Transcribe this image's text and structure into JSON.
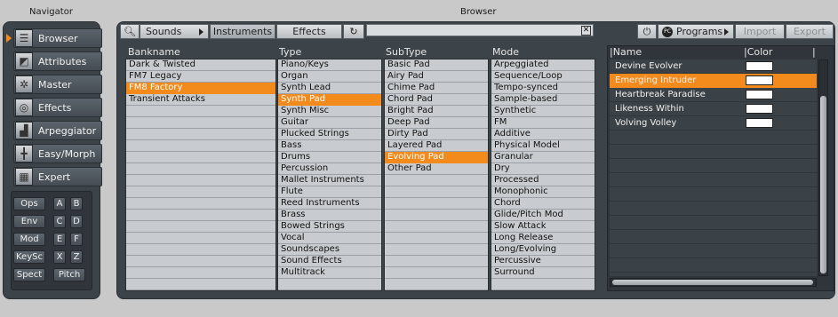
{
  "navigator": {
    "title": "Navigator",
    "items": [
      {
        "label": "Browser",
        "icon": "list-icon"
      },
      {
        "label": "Attributes",
        "icon": "slider-icon"
      },
      {
        "label": "Master",
        "icon": "gear-icon"
      },
      {
        "label": "Effects",
        "icon": "target-icon"
      },
      {
        "label": "Arpeggiator",
        "icon": "bars-icon"
      },
      {
        "label": "Easy/Morph",
        "icon": "grid-icon"
      },
      {
        "label": "Expert",
        "icon": "expert-icon"
      }
    ],
    "ops": {
      "ops": "Ops",
      "env": "Env",
      "mod": "Mod",
      "keysc": "KeySc",
      "spect": "Spect",
      "pitch": "Pitch",
      "a": "A",
      "b": "B",
      "c": "C",
      "d": "D",
      "e": "E",
      "f": "F",
      "x": "X",
      "z": "Z"
    }
  },
  "browser": {
    "title": "Browser",
    "toolbar": {
      "sounds": "Sounds",
      "instruments": "Instruments",
      "effects": "Effects",
      "programs": "Programs",
      "import": "Import",
      "export": "Export",
      "search_value": "",
      "clear_glyph": "✕"
    },
    "columns": {
      "bankname": {
        "header": "Bankname",
        "items": [
          "Dark & Twisted",
          "FM7 Legacy",
          "FM8 Factory",
          "Transient Attacks"
        ]
      },
      "type": {
        "header": "Type",
        "items": [
          "Piano/Keys",
          "Organ",
          "Synth Lead",
          "Synth Pad",
          "Synth Misc",
          "Guitar",
          "Plucked Strings",
          "Bass",
          "Drums",
          "Percussion",
          "Mallet Instruments",
          "Flute",
          "Reed Instruments",
          "Brass",
          "Bowed Strings",
          "Vocal",
          "Soundscapes",
          "Sound Effects",
          "Multitrack"
        ]
      },
      "subtype": {
        "header": "SubType",
        "items": [
          "Basic Pad",
          "Airy Pad",
          "Chime Pad",
          "Chord Pad",
          "Bright Pad",
          "Deep Pad",
          "Dirty Pad",
          "Layered Pad",
          "Evolving Pad",
          "Other Pad"
        ]
      },
      "mode": {
        "header": "Mode",
        "items": [
          "Arpeggiated",
          "Sequence/Loop",
          "Tempo-synced",
          "Sample-based",
          "Synthetic",
          "FM",
          "Additive",
          "Physical Model",
          "Granular",
          "Dry",
          "Processed",
          "Monophonic",
          "Chord",
          "Glide/Pitch Mod",
          "Slow Attack",
          "Long Release",
          "Long/Evolving",
          "Percussive",
          "Surround"
        ]
      }
    },
    "results": {
      "name_header": "Name",
      "color_header": "Color",
      "items": [
        "Devine Evolver",
        "Emerging Intruder",
        "Heartbreak Paradise",
        "Likeness Within",
        "Volving Volley"
      ]
    }
  },
  "colors": {
    "accent": "#f28a1c",
    "panel": "#3c4349",
    "list": "#c8ccd0"
  }
}
